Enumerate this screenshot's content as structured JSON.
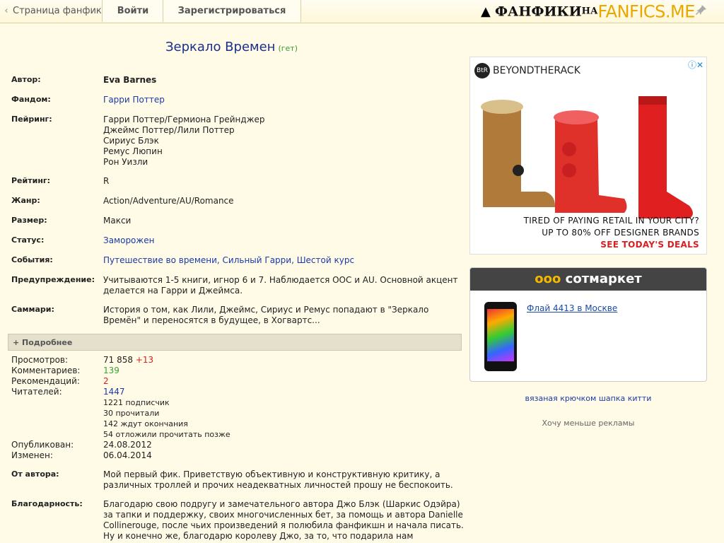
{
  "topbar": {
    "crumb_arrow": "‹",
    "crumb": "Страница фанфика",
    "login": "Войти",
    "register": "Зарегистрироваться",
    "logo_part1": "ФАНФИКИ",
    "logo_part2": "НА",
    "logo_part3": "FANFICS.ME"
  },
  "fic": {
    "title": "Зеркало Времен",
    "tag": "(гет)",
    "fields": {
      "author_label": "Автор:",
      "author": "Eva Barnes",
      "fandom_label": "Фандом:",
      "fandom": "Гарри Поттер",
      "pairing_label": "Пейринг:",
      "pairing": [
        "Гарри Поттер/Гермиона Грейнджер",
        "Джеймс Поттер/Лили Поттер",
        "Сириус Блэк",
        "Ремус Люпин",
        "Рон Уизли"
      ],
      "rating_label": "Рейтинг:",
      "rating": "R",
      "genre_label": "Жанр:",
      "genre": "Action/Adventure/AU/Romance",
      "size_label": "Размер:",
      "size": "Макси",
      "status_label": "Статус:",
      "status": "Заморожен",
      "events_label": "События:",
      "events": "Путешествие во времени, Сильный Гарри, Шестой курс",
      "warning_label": "Предупреждение:",
      "warning": "Учитываются 1-5 книги, игнор 6 и 7. Наблюдается ООС и AU. Основной акцент делается на Гарри и Джеймса.",
      "summary_label": "Саммари:",
      "summary": "История о том, как Лили, Джеймс, Сириус и Ремус попадают в \"Зеркало Времён\" и переносятся в будущее, в Хогвартс..."
    },
    "more": "+ Подробнее",
    "stats": {
      "views_label": "Просмотров:",
      "views": "71 858",
      "views_delta": "+13",
      "comments_label": "Комментариев:",
      "comments": "139",
      "recs_label": "Рекомендаций:",
      "recs": "2",
      "readers_label": "Читателей:",
      "readers": "1447",
      "subs": "1221 подписчик",
      "read": "30 прочитали",
      "waiting": "142 ждут окончания",
      "later": "54 отложили прочитать позже",
      "published_label": "Опубликован:",
      "published": "24.08.2012",
      "changed_label": "Изменен:",
      "changed": "06.04.2014"
    },
    "from_author_label": "От автора:",
    "from_author": "Мой первый фик. Приветствую объективную и конструктивную критику, а различных троллей и прочих неадекватных личностей прошу не беспокоить.",
    "thanks_label": "Благодарность:",
    "thanks": "Благодарю свою подругу и замечательного автора Джо Блэк (Шаркис Одэйра) за тапки и поддержку, своих многочисленных бет, за помощь и автора Danielle Collinerouge, после чьих произведений я полюбила фанфикшн и начала писать. Ну и конечно же, благодарю королеву Джо, за то, что подарила нам"
  },
  "ads": {
    "brand": "BEYONDTHERACK",
    "brand_short": "BtR",
    "line1": "TIRED OF PAYING RETAIL IN YOUR CITY?",
    "line2": "UP TO 80% OFF DESIGNER BRANDS",
    "line3": "SEE TODAY'S DEALS",
    "market": "сотмаркет",
    "market_mark": "ooo",
    "phone_link": "Флай 4413 в Москве",
    "knit_link": "вязаная крючком шапка китти",
    "less_ads": "Хочу меньше рекламы"
  },
  "colors": {
    "accent_link": "#1a3aa8",
    "title": "#1a2f8a",
    "ad_red": "#d82020"
  }
}
